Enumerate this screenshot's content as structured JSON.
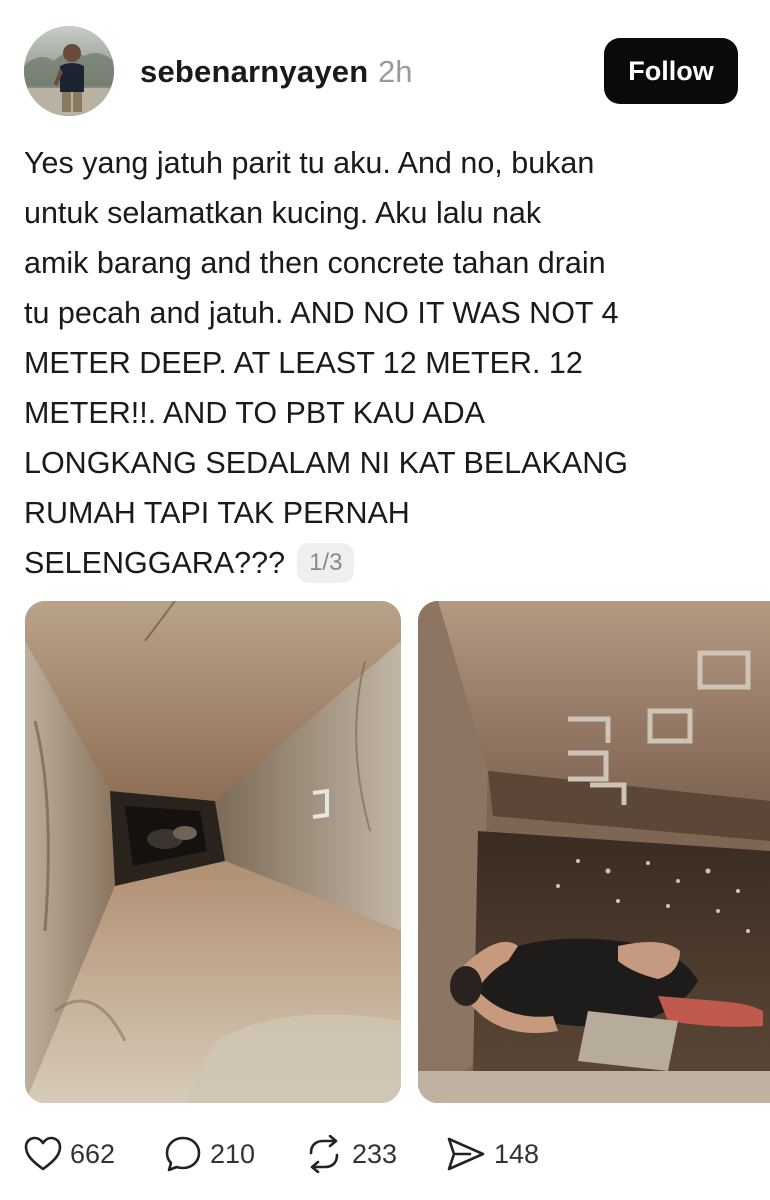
{
  "post": {
    "author": {
      "username": "sebenarnyayen",
      "time_ago": "2h",
      "follow_label": "Follow"
    },
    "text_lines": [
      "Yes yang jatuh parit tu aku. And no, bukan",
      "untuk selamatkan kucing. Aku lalu nak",
      "amik barang and then concrete tahan drain",
      "tu pecah and jatuh. AND NO IT WAS NOT 4",
      "METER DEEP. AT LEAST 12 METER. 12",
      "METER!!. AND TO PBT KAU ADA",
      "LONGKANG SEDALAM NI KAT BELAKANG",
      "RUMAH TAPI TAK PERNAH",
      "SELENGGARA???"
    ],
    "page_indicator": "1/3",
    "stats": {
      "likes": "662",
      "replies": "210",
      "reposts": "233",
      "shares": "148"
    },
    "icons": {
      "like": "heart-icon",
      "reply": "speech-bubble-icon",
      "repost": "repost-arrows-icon",
      "share": "paper-plane-icon"
    }
  }
}
